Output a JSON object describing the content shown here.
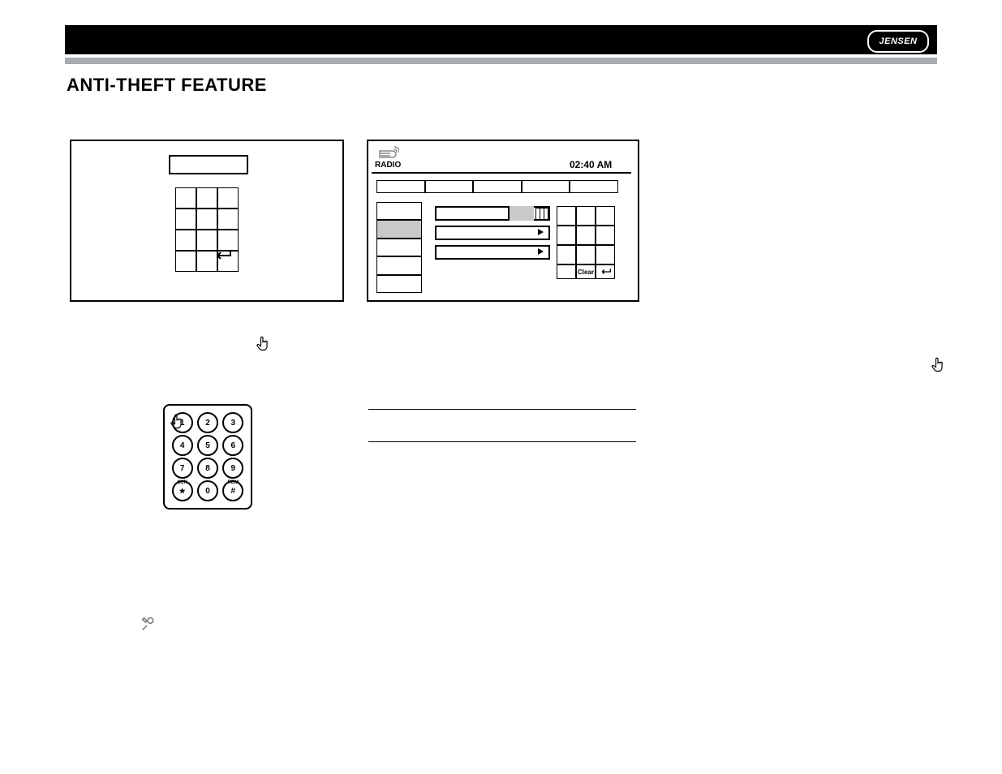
{
  "brand": "JENSEN",
  "page_title": "ANTI-THEFT FEATURE",
  "fig_b": {
    "radio_label": "RADIO",
    "clock": "02:40 AM",
    "keypad_bottom": {
      "clear": "Clear"
    }
  },
  "remote": {
    "keys": [
      "1",
      "2",
      "3",
      "4",
      "5",
      "6",
      "7",
      "8",
      "9",
      "★",
      "0",
      "#"
    ],
    "scn": "SCN",
    "rdm": "RDM"
  }
}
